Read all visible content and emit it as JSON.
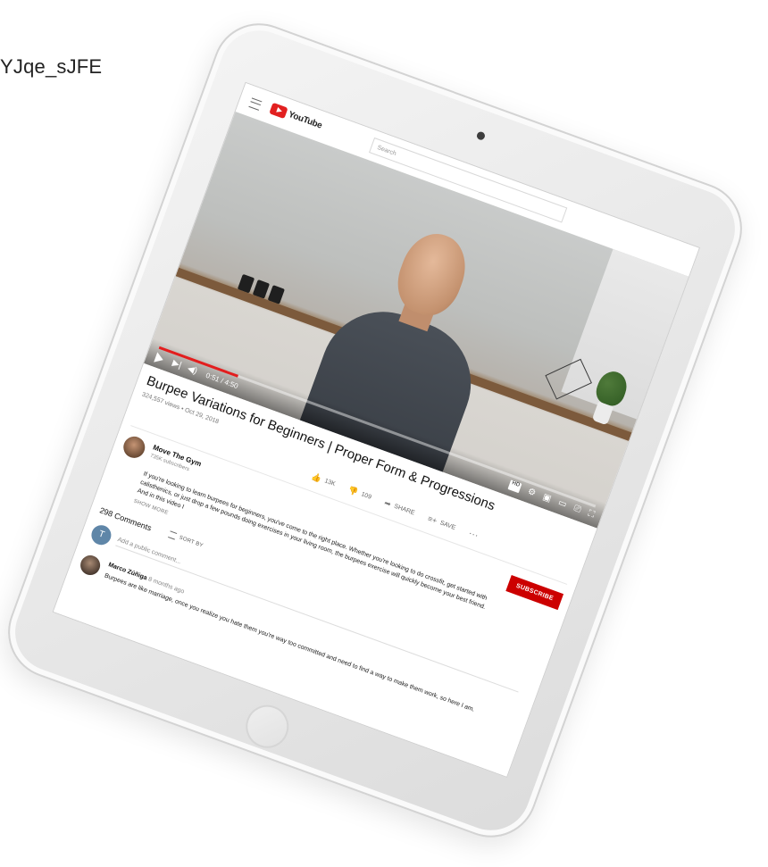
{
  "page": {
    "url_fragment": "YJqe_sJFE"
  },
  "app": {
    "logo": "YouTube",
    "search_placeholder": "Search"
  },
  "player": {
    "time": "0:51 / 4:50",
    "progress_fraction": 0.18,
    "hd_badge": "HD"
  },
  "video": {
    "title": "Burpee Variations for Beginners | Proper Form & Progressions",
    "meta": "324,557 views • Oct 29, 2018",
    "likes": "13K",
    "dislikes": "109",
    "share_label": "SHARE",
    "save_label": "SAVE"
  },
  "channel": {
    "name": "Move The Gym",
    "subscribers": "735K subscribers",
    "subscribe_label": "SUBSCRIBE"
  },
  "description": {
    "text": "If you're looking to learn burpees for beginners, you've come to the right place. Whether you're looking to do crossfit, get started with calisthenics, or just drop a few pounds doing exercises in your living room, the burpees exercise will quickly become your best friend. And in this video I",
    "show_more": "SHOW MORE"
  },
  "comments": {
    "count_label": "298 Comments",
    "sort_label": "SORT BY",
    "input_placeholder": "Add a public comment...",
    "user_initial": "T",
    "items": [
      {
        "author": "Marco Zúñiga",
        "time": "8 months ago",
        "text": "Burpees are like marriage, once you realize you hate them you're way too committed and need to find a way to make them work, so here I am."
      }
    ]
  }
}
